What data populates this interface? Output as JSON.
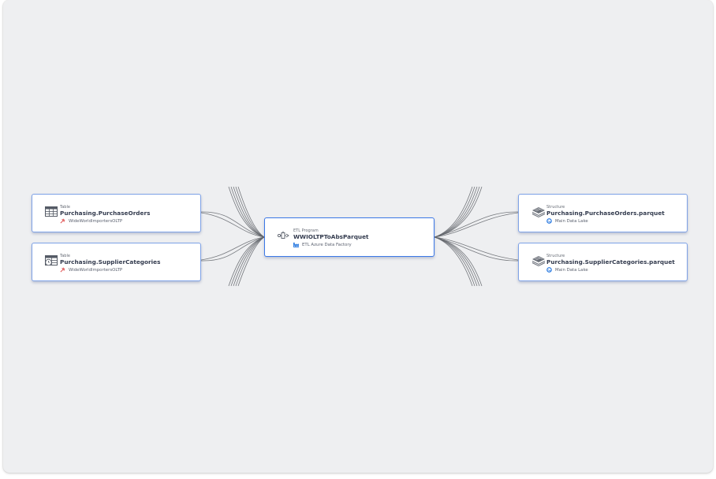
{
  "nodes": {
    "source_1": {
      "type": "Table",
      "title": "Purchasing.PurchaseOrders",
      "source": "WideWorldImportersOLTP",
      "icon": "table-icon",
      "source_icon": "database-pin-icon"
    },
    "source_2": {
      "type": "Table",
      "title": "Purchasing.SupplierCategories",
      "source": "WideWorldImportersOLTP",
      "icon": "temporal-table-icon",
      "source_icon": "database-pin-icon"
    },
    "process": {
      "type": "ETL Program",
      "title": "WWIOLTPToAbsParquet",
      "source": "ETL Azure Data Factory",
      "icon": "etl-pipeline-icon",
      "source_icon": "factory-icon"
    },
    "target_1": {
      "type": "Structure",
      "title": "Purchasing.PurchaseOrders.parquet",
      "source": "Main Data Lake",
      "icon": "structure-layers-icon",
      "source_icon": "data-lake-icon"
    },
    "target_2": {
      "type": "Structure",
      "title": "Purchasing.SupplierCategories.parquet",
      "source": "Main Data Lake",
      "icon": "structure-layers-icon",
      "source_icon": "data-lake-icon"
    }
  },
  "colors": {
    "canvas": "#eeeff1",
    "node_border": "#7ea2e6",
    "selected_border": "#3b78e7",
    "link": "#5f6368",
    "db_pin": "#e05555",
    "lake": "#2f7de1"
  }
}
